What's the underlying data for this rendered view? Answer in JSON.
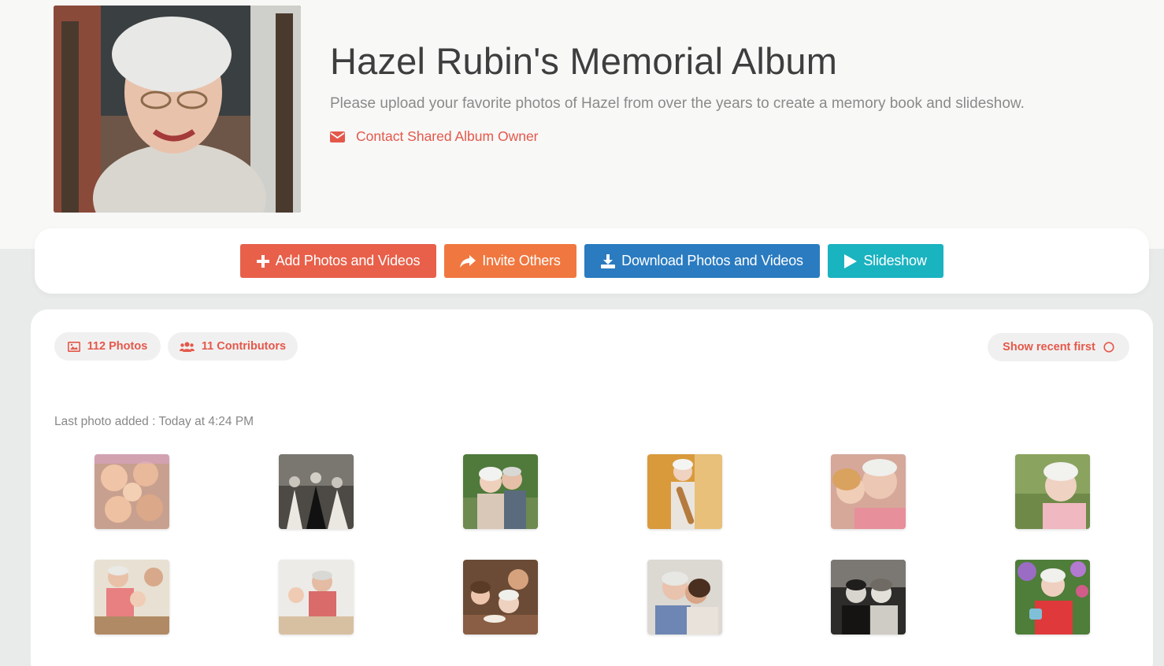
{
  "album": {
    "title": "Hazel Rubin's Memorial Album",
    "description": "Please upload your favorite photos of Hazel from over the years to create a memory book and slideshow.",
    "contact_label": "Contact Shared Album Owner"
  },
  "actions": {
    "add_label": "Add Photos and Videos",
    "invite_label": "Invite Others",
    "download_label": "Download Photos and Videos",
    "slideshow_label": "Slideshow"
  },
  "stats": {
    "photos_label": "112 Photos",
    "contributors_label": "11 Contributors",
    "sort_label": "Show recent first"
  },
  "last_added": "Last photo added : Today at 4:24 PM",
  "icons": {
    "contact": "envelope-icon",
    "add": "plus-icon",
    "invite": "share-arrow-icon",
    "download": "download-icon",
    "slideshow": "play-icon",
    "photos": "image-icon",
    "contributors": "users-icon",
    "sort": "circle-icon"
  },
  "colors": {
    "accent": "#e4584a",
    "add_button": "#e8604a",
    "invite_button": "#f0773f",
    "download_button": "#2a7bc0",
    "slideshow_button": "#1ab3c0"
  }
}
